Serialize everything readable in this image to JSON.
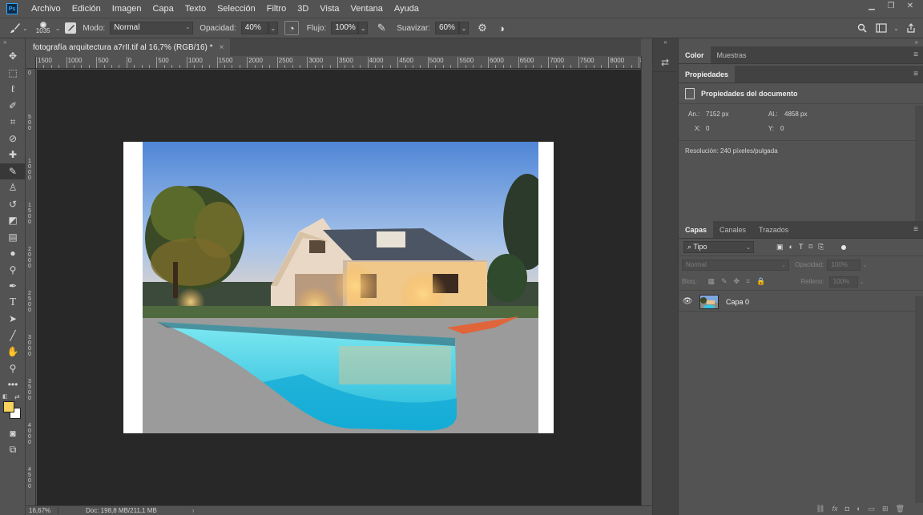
{
  "menu": {
    "logo": "Ps",
    "items": [
      "Archivo",
      "Edición",
      "Imagen",
      "Capa",
      "Texto",
      "Selección",
      "Filtro",
      "3D",
      "Vista",
      "Ventana",
      "Ayuda"
    ]
  },
  "options": {
    "brush_size": "1035",
    "mode_label": "Modo:",
    "mode_value": "Normal",
    "opacity_label": "Opacidad:",
    "opacity_value": "40%",
    "flow_label": "Flujo:",
    "flow_value": "100%",
    "smoothing_label": "Suavizar:",
    "smoothing_value": "60%"
  },
  "document": {
    "tab_title": "fotografía arquitectura a7rII.tif al 16,7% (RGB/16) *",
    "tab_close": "×"
  },
  "ruler_top": [
    "1500",
    "1000",
    "500",
    "0",
    "500",
    "1000",
    "1500",
    "2000",
    "2500",
    "3000",
    "3500",
    "4000",
    "4500",
    "5000",
    "5500",
    "6000",
    "6500",
    "7000",
    "7500",
    "8000",
    "85"
  ],
  "ruler_left": [
    "0",
    "5\n0\n0",
    "1\n0\n0\n0",
    "1\n5\n0\n0",
    "2\n0\n0\n0",
    "2\n5\n0\n0",
    "3\n0\n0\n0",
    "3\n5\n0\n0",
    "4\n0\n0\n0",
    "4\n5\n0\n0"
  ],
  "status": {
    "zoom": "16,67%",
    "doc": "Doc: 198,8 MB/211,1 MB",
    "arrow": "›"
  },
  "panels": {
    "color_tabs": [
      "Color",
      "Muestras"
    ],
    "properties_tab": "Propiedades",
    "properties_header": "Propiedades del documento",
    "width_label": "An.:",
    "width_value": "7152 px",
    "height_label": "Al.:",
    "height_value": "4858 px",
    "x_label": "X:",
    "x_value": "0",
    "y_label": "Y:",
    "y_value": "0",
    "resolution": "Resolución: 240 píxeles/pulgada",
    "layer_tabs": [
      "Capas",
      "Canales",
      "Trazados"
    ],
    "kind_filter": "⌕ Tipo",
    "blend_mode": "Normal",
    "opacity_label": "Opacidad:",
    "opacity_value": "100%",
    "lock_label": "Bloq.:",
    "fill_label": "Relleno:",
    "fill_value": "100%",
    "layers": [
      {
        "name": "Capa 0",
        "visible": true
      }
    ]
  },
  "colors": {
    "foreground": "#f6d35e",
    "background": "#ffffff",
    "canvas_bg": "#282828",
    "ui_panel": "#535353",
    "ps_accent": "#31a8ff"
  }
}
